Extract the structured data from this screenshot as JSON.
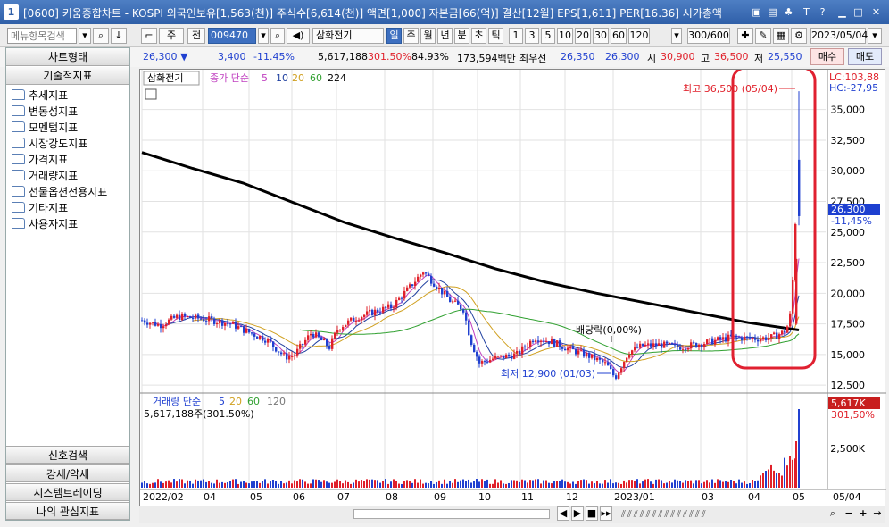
{
  "window": {
    "title": "[0600] 키움종합차트 - KOSPI 외국인보유[1,563(천)] 주식수[6,614(천)] 액면[1,000] 자본금[66(억)] 결산[12월] EPS[1,611] PER[16.36] 시가총액",
    "app_icon": "1"
  },
  "toolbar": {
    "search_placeholder": "메뉴항목검색",
    "type": "주",
    "period_sel": "전",
    "code": "009470",
    "stock_name": "삼화전기",
    "periods": [
      "일",
      "주",
      "월",
      "년",
      "분",
      "초",
      "틱"
    ],
    "active_period": "일",
    "intervals": [
      "1",
      "3",
      "5",
      "10",
      "20",
      "30",
      "60",
      "120"
    ],
    "count": "300/600",
    "date": "2023/05/04"
  },
  "info": {
    "price": "26,300",
    "change": "3,400",
    "pct": "-11.45%",
    "volume": "5,617,188",
    "vol_ratio": "301.50%",
    "turnover": "84.93%",
    "amount": "173,594백만",
    "min_label": "최우선",
    "ask": "26,350",
    "bid": "26,300",
    "open_l": "시",
    "open": "30,900",
    "high_l": "고",
    "high": "36,500",
    "low_l": "저",
    "low": "25,550",
    "buy": "매수",
    "sell": "매도"
  },
  "sidebar": {
    "top_title": "차트형태",
    "section": "기술적지표",
    "folders": [
      "추세지표",
      "변동성지표",
      "모멘텀지표",
      "시장강도지표",
      "가격지표",
      "거래량지표",
      "선물옵션전용지표",
      "기타지표",
      "사용자지표"
    ],
    "bottom": [
      "신호검색",
      "강세/약세",
      "시스템트레이딩",
      "나의 관심지표"
    ]
  },
  "chart": {
    "price_legend": {
      "name": "삼화전기",
      "ma_label": "종가 단순",
      "ma": [
        "5",
        "10",
        "20",
        "60",
        "224"
      ]
    },
    "vol_legend": {
      "label": "거래량 단순",
      "ma": [
        "5",
        "20",
        "60",
        "120"
      ],
      "value": "5,617,188주(301.50%)"
    },
    "lc": "LC:103,88",
    "hc": "HC:-27,95",
    "cur_price": "26,300",
    "cur_pct": "-11,45%",
    "vol_cur": "5,617K",
    "vol_pct": "301,50%",
    "high_ann": "최고 36,500 (05/04)",
    "low_ann": "최저 12,900 (01/03)",
    "div_ann": "배당락(0,00%)",
    "y_ticks": [
      "35,000",
      "32,500",
      "30,000",
      "27,500",
      "25,000",
      "22,500",
      "20,000",
      "17,500",
      "15,000",
      "12,500"
    ],
    "vol_tick": "2,500K",
    "x_ticks": [
      "2022/02",
      "04",
      "05",
      "06",
      "07",
      "08",
      "09",
      "10",
      "11",
      "12",
      "2023/01",
      "03",
      "04",
      "05",
      "05/04"
    ],
    "colors": {
      "up": "#e0202a",
      "down": "#2040d0",
      "ma5": "#c040c0",
      "ma10": "#2040a0",
      "ma20": "#d0a020",
      "ma60": "#30a030",
      "ma224": "#000000",
      "highlight": "#e02030"
    }
  },
  "chart_data": {
    "type": "candlestick",
    "x": [
      "2022/02",
      "04",
      "05",
      "06",
      "07",
      "08",
      "09",
      "10",
      "11",
      "12",
      "2023/01",
      "03",
      "04",
      "05"
    ],
    "close": [
      17600,
      18400,
      17300,
      15900,
      16800,
      19300,
      20200,
      14800,
      15900,
      15300,
      13600,
      16200,
      16600,
      26300
    ],
    "ma224": [
      31500,
      30200,
      29000,
      27400,
      25800,
      24500,
      23300,
      22000,
      20900,
      20000,
      19200,
      18400,
      17600,
      17000
    ],
    "ylim": [
      12500,
      36500
    ],
    "high": 36500,
    "low": 12900
  }
}
